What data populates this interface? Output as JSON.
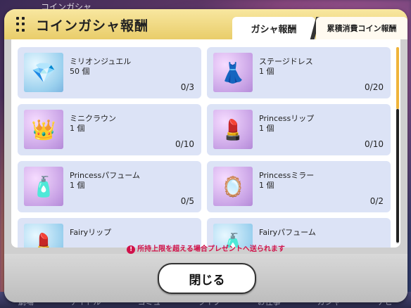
{
  "background": {
    "title": "コインガシャ"
  },
  "nav": [
    "劇場",
    "アイドル",
    "コミュ",
    "ライブ",
    "お仕事",
    "ガシャ",
    "ナビ"
  ],
  "dialog": {
    "title": "コインガシャ報酬",
    "tabs": [
      "ガシャ報酬",
      "累積消費コイン報酬"
    ],
    "active_tab": "ガシャ報酬"
  },
  "items": [
    {
      "name": "ミリオンジュエル",
      "qty": "50 個",
      "count": "0/3",
      "icon": "jewel-icon"
    },
    {
      "name": "ステージドレス",
      "qty": "1 個",
      "count": "0/20",
      "icon": "dress-icon"
    },
    {
      "name": "ミニクラウン",
      "qty": "1 個",
      "count": "0/10",
      "icon": "crown-icon"
    },
    {
      "name": "Princessリップ",
      "qty": "1 個",
      "count": "0/10",
      "icon": "lipstick-icon"
    },
    {
      "name": "Princessパフューム",
      "qty": "1 個",
      "count": "0/5",
      "icon": "perfume-icon"
    },
    {
      "name": "Princessミラー",
      "qty": "1 個",
      "count": "0/2",
      "icon": "mirror-icon"
    },
    {
      "name": "Fairyリップ",
      "qty": "",
      "count": "",
      "icon": "lipstick-icon"
    },
    {
      "name": "Fairyパフューム",
      "qty": "",
      "count": "",
      "icon": "perfume-icon"
    }
  ],
  "note": "所持上限を超える場合プレゼントへ送られます",
  "close_label": "閉じる"
}
